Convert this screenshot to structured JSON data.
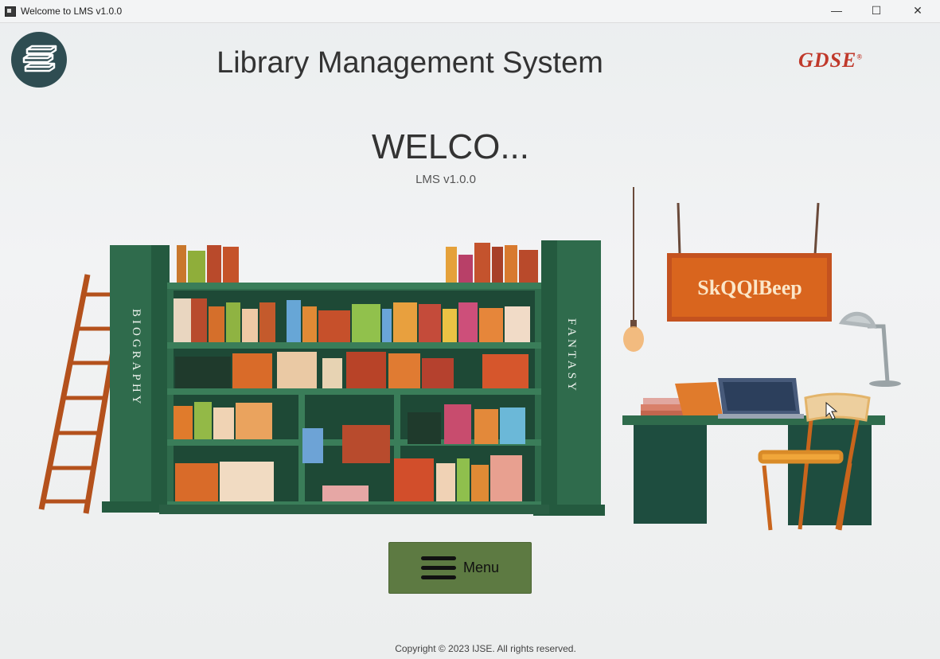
{
  "window": {
    "title": "Welcome to LMS v1.0.0",
    "controls": {
      "minimize": "—",
      "maximize": "☐",
      "close": "✕"
    }
  },
  "header": {
    "logo_icon": "books-stack-icon",
    "app_title": "Library Management System",
    "brand_logo": "GDSE",
    "brand_mark": "®"
  },
  "main": {
    "welcome_text": "WELCO...",
    "version_text": "LMS v1.0.0",
    "illustration": {
      "left_shelf_label": "BIOGRAPHY",
      "right_shelf_label": "FANTASY",
      "sign_text": "SkQQlBeep"
    },
    "menu_button": {
      "icon": "hamburger-menu-icon",
      "label": "Menu"
    }
  },
  "footer": {
    "copyright": "Copyright © 2023 IJSE. All rights reserved."
  },
  "colors": {
    "logo_bg": "#2f4d52",
    "shelf_green": "#2f6b4c",
    "menu_button": "#5d7a42",
    "brand_red": "#c0392b",
    "sign_orange": "#d9651e"
  }
}
